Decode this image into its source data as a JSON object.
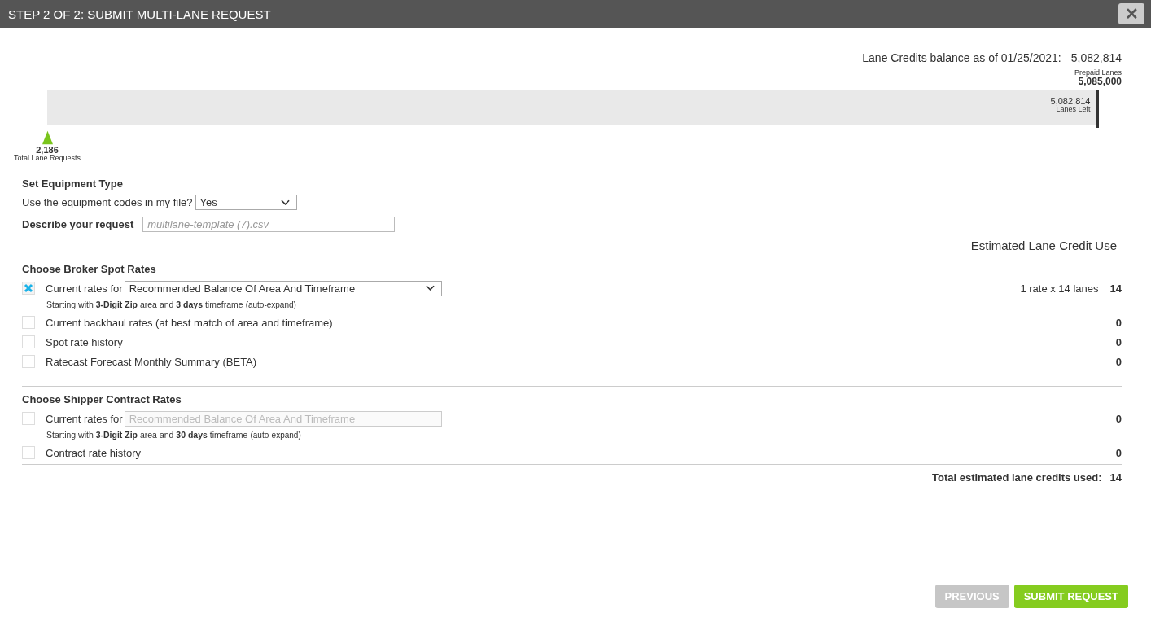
{
  "window": {
    "title": "STEP 2 OF 2: SUBMIT MULTI-LANE REQUEST",
    "close": "✕"
  },
  "balance": {
    "label": "Lane Credits balance as of 01/25/2021:",
    "value": "5,082,814"
  },
  "meter": {
    "prepaid_label": "Prepaid Lanes",
    "prepaid_value": "5,085,000",
    "left_value": "5,082,814",
    "left_label": "Lanes Left",
    "level": 0.9996,
    "requests_value": "2,186",
    "requests_label": "Total Lane Requests"
  },
  "equipment": {
    "heading": "Set Equipment Type",
    "question": "Use the equipment codes in my file?",
    "value": "Yes"
  },
  "describe": {
    "label": "Describe your request",
    "placeholder": "multilane-template (7).csv"
  },
  "credit_header": "Estimated Lane Credit Use",
  "sections": [
    {
      "heading": "Choose Broker Spot Rates",
      "options": [
        {
          "label": "Current rates for",
          "checked": true,
          "select": {
            "value": "Recommended Balance Of Area And Timeframe",
            "disabled": false
          },
          "hint": "Starting with **3-Digit Zip** area and **3 days** timeframe",
          "hint_note": "(auto-expand)",
          "detail": "1 rate x 14 lanes",
          "credit": "14"
        },
        {
          "label": "Current backhaul rates (at best match of area and timeframe)",
          "checked": false,
          "credit": "0"
        },
        {
          "label": "Spot rate history",
          "checked": false,
          "credit": "0"
        },
        {
          "label": "Ratecast Forecast Monthly Summary (BETA)",
          "checked": false,
          "credit": "0"
        }
      ]
    },
    {
      "heading": "Choose Shipper Contract Rates",
      "options": [
        {
          "label": "Current rates for",
          "checked": false,
          "select": {
            "placeholder": "Recommended Balance Of Area And Timeframe",
            "disabled": true
          },
          "hint": "Starting with **3-Digit Zip** area and **30 days** timeframe",
          "hint_note": "(auto-expand)",
          "credit": "0"
        },
        {
          "label": "Contract rate history",
          "checked": false,
          "credit": "0"
        }
      ]
    }
  ],
  "total": {
    "label": "Total estimated lane credits used:",
    "value": "14"
  },
  "buttons": [
    {
      "label": "PREVIOUS",
      "kind": "secondary",
      "disabled": true
    },
    {
      "label": "SUBMIT REQUEST",
      "kind": "primary",
      "disabled": false
    }
  ]
}
